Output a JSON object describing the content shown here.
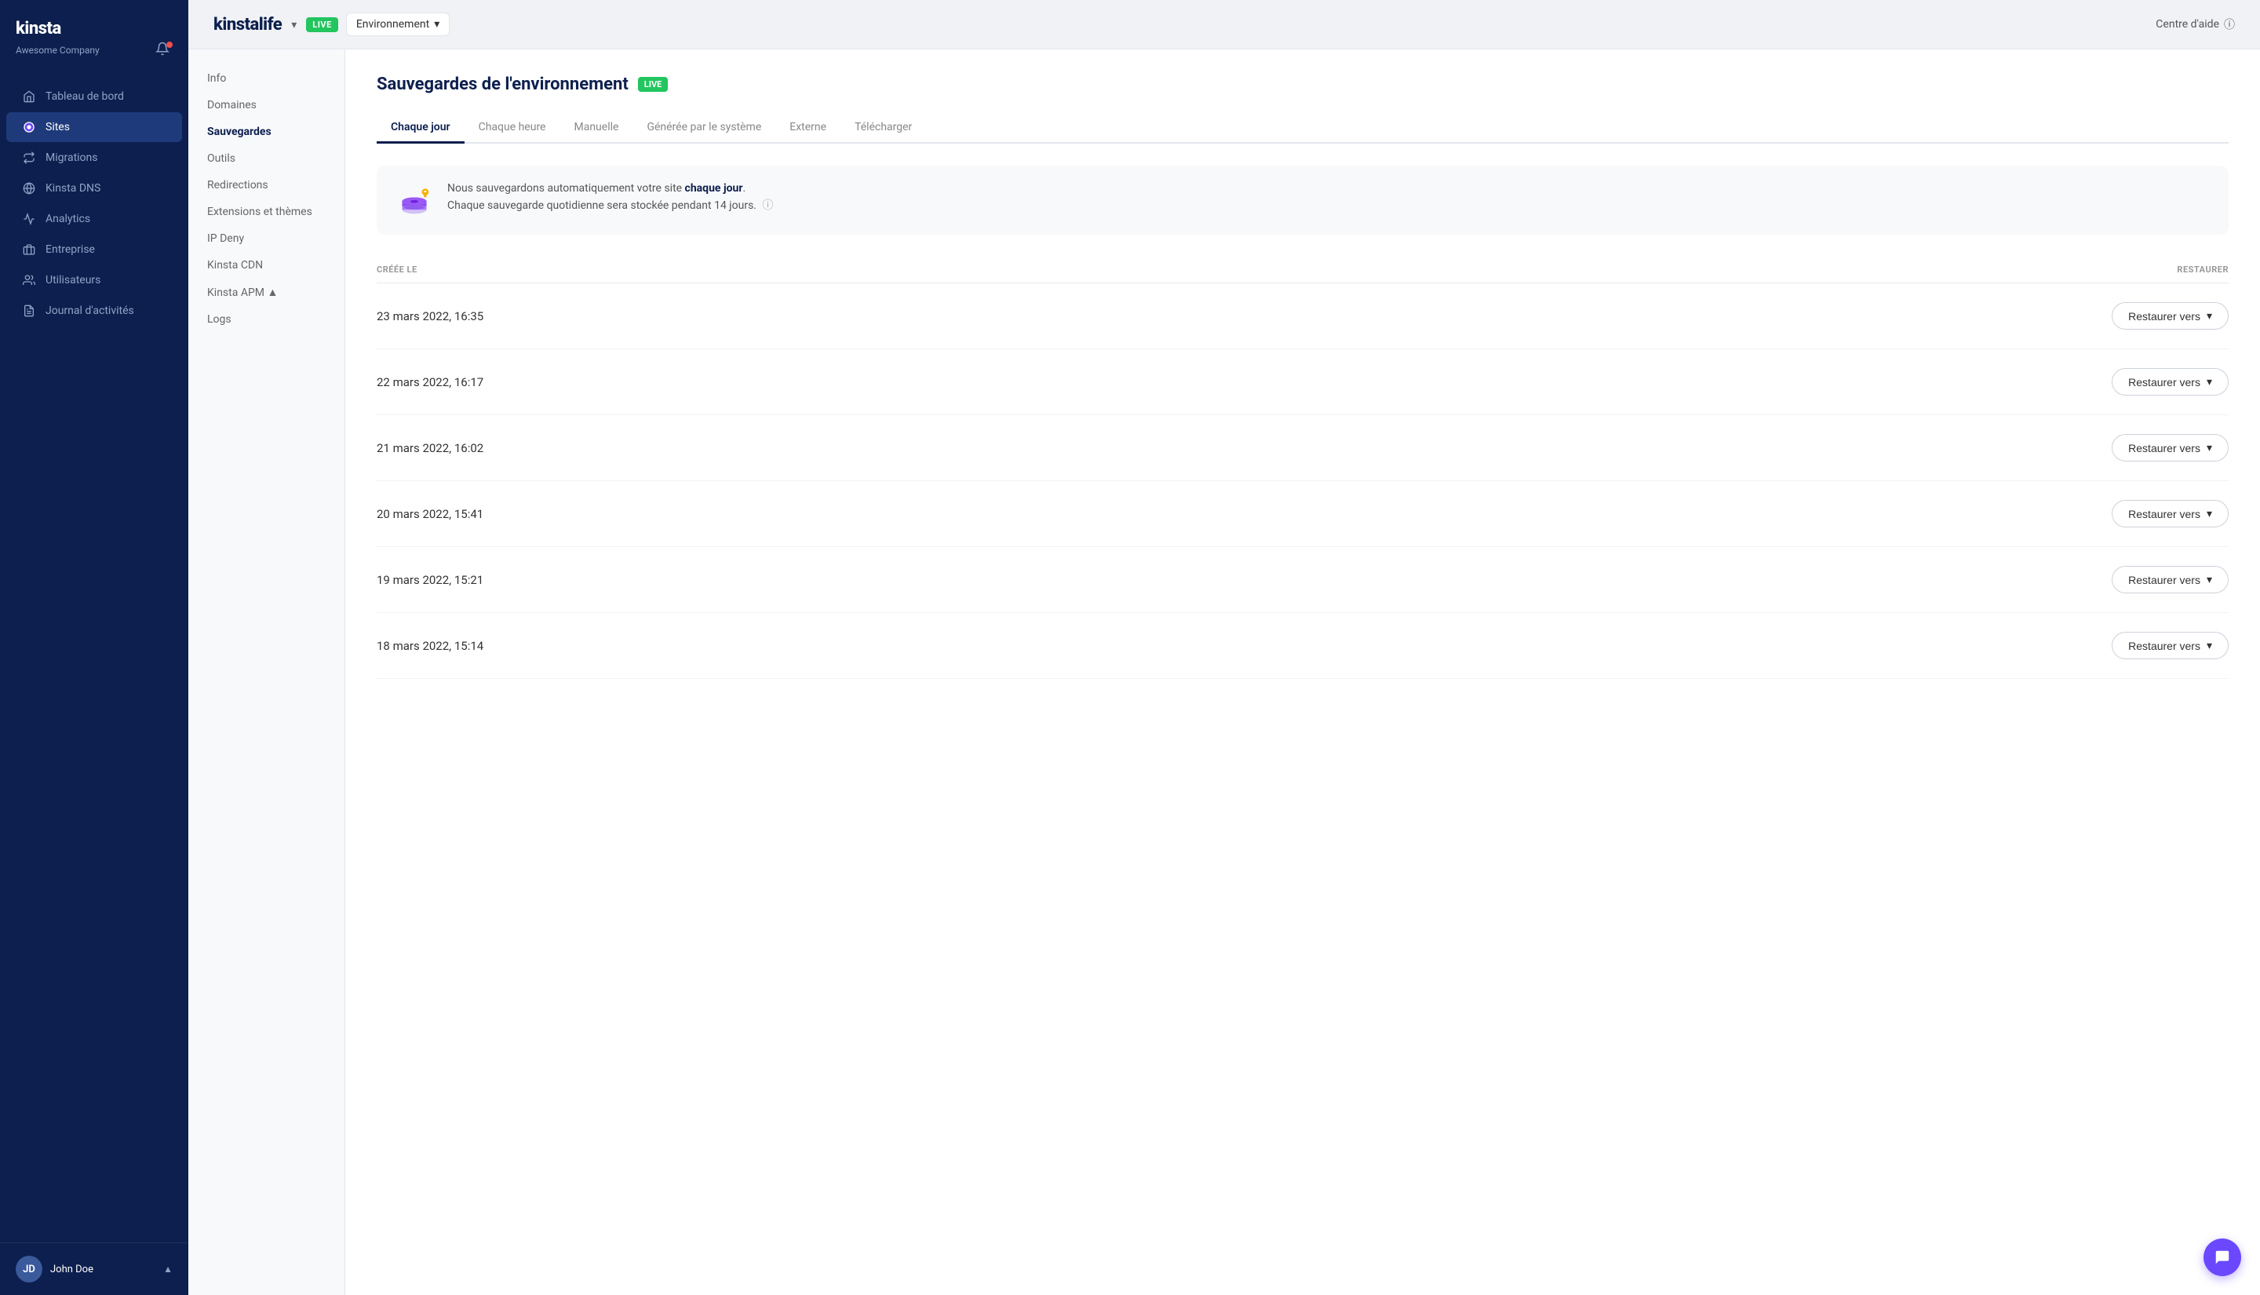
{
  "sidebar": {
    "logo": "kinsta",
    "company": "Awesome Company",
    "nav": [
      {
        "id": "tableau-de-bord",
        "label": "Tableau de bord",
        "icon": "home",
        "active": false
      },
      {
        "id": "sites",
        "label": "Sites",
        "icon": "sites",
        "active": true
      },
      {
        "id": "migrations",
        "label": "Migrations",
        "icon": "migrations",
        "active": false
      },
      {
        "id": "kinsta-dns",
        "label": "Kinsta DNS",
        "icon": "dns",
        "active": false
      },
      {
        "id": "analytics",
        "label": "Analytics",
        "icon": "analytics",
        "active": false
      },
      {
        "id": "entreprise",
        "label": "Entreprise",
        "icon": "entreprise",
        "active": false
      },
      {
        "id": "utilisateurs",
        "label": "Utilisateurs",
        "icon": "users",
        "active": false
      },
      {
        "id": "journal-activites",
        "label": "Journal d'activités",
        "icon": "journal",
        "active": false
      }
    ],
    "user": {
      "name": "John Doe",
      "initials": "JD"
    }
  },
  "topbar": {
    "site_name": "kinstalife",
    "live_badge": "LIVE",
    "env_label": "Environnement",
    "help_label": "Centre d'aide"
  },
  "sub_nav": [
    {
      "id": "info",
      "label": "Info",
      "active": false
    },
    {
      "id": "domaines",
      "label": "Domaines",
      "active": false
    },
    {
      "id": "sauvegardes",
      "label": "Sauvegardes",
      "active": true
    },
    {
      "id": "outils",
      "label": "Outils",
      "active": false
    },
    {
      "id": "redirections",
      "label": "Redirections",
      "active": false
    },
    {
      "id": "extensions-themes",
      "label": "Extensions et thèmes",
      "active": false
    },
    {
      "id": "ip-deny",
      "label": "IP Deny",
      "active": false
    },
    {
      "id": "kinsta-cdn",
      "label": "Kinsta CDN",
      "active": false
    },
    {
      "id": "kinsta-apm",
      "label": "Kinsta APM ▲",
      "active": false
    },
    {
      "id": "logs",
      "label": "Logs",
      "active": false
    }
  ],
  "page": {
    "title": "Sauvegardes de l'environnement",
    "live_badge": "LIVE",
    "tabs": [
      {
        "id": "chaque-jour",
        "label": "Chaque jour",
        "active": true
      },
      {
        "id": "chaque-heure",
        "label": "Chaque heure",
        "active": false
      },
      {
        "id": "manuelle",
        "label": "Manuelle",
        "active": false
      },
      {
        "id": "generee-systeme",
        "label": "Générée par le système",
        "active": false
      },
      {
        "id": "externe",
        "label": "Externe",
        "active": false
      },
      {
        "id": "telecharger",
        "label": "Télécharger",
        "active": false
      }
    ],
    "info_text_1": "Nous sauvegardons automatiquement votre site ",
    "info_bold": "chaque jour",
    "info_text_2": ".",
    "info_text_3": "Chaque sauvegarde quotidienne sera stockée pendant 14 jours.",
    "table": {
      "col_date": "CRÉÉE LE",
      "col_action": "RESTAURER",
      "rows": [
        {
          "date": "23 mars 2022, 16:35",
          "action": "Restaurer vers"
        },
        {
          "date": "22 mars 2022, 16:17",
          "action": "Restaurer vers"
        },
        {
          "date": "21 mars 2022, 16:02",
          "action": "Restaurer vers"
        },
        {
          "date": "20 mars 2022, 15:41",
          "action": "Restaurer vers"
        },
        {
          "date": "19 mars 2022, 15:21",
          "action": "Restaurer vers"
        },
        {
          "date": "18 mars 2022, 15:14",
          "action": "Restaurer vers"
        }
      ]
    }
  }
}
